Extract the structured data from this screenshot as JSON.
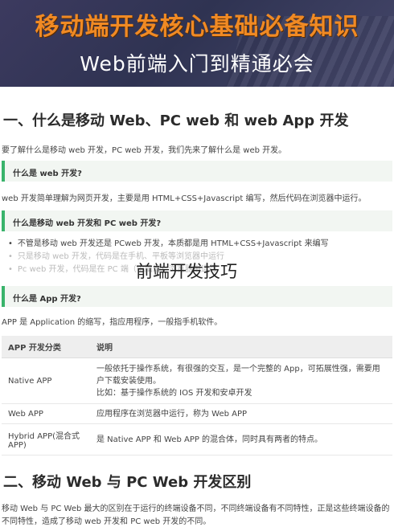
{
  "banner": {
    "title": "移动端开发核心基础必备知识",
    "subtitle": "Web前端入门到精通必会"
  },
  "section1": {
    "heading": "一、什么是移动 Web、PC web 和 web App 开发",
    "intro": "要了解什么是移动 web 开发，PC web 开发，我们先来了解什么是 web 开发。",
    "callout_web": "什么是 web 开发?",
    "web_desc": "web 开发简单理解为网页开发，主要是用 HTML+CSS+Javascript 编写，然后代码在浏览器中运行。",
    "callout_mobile_pc": "什么是移动 web 开发和 PC web 开发?",
    "bullets": [
      "不管是移动 web 开发还是 PCweb 开发，本质都是用 HTML+CSS+Javascript 来编写",
      "只是移动 web 开发，代码是在手机、平板等浏览器中运行",
      "Pc web 开发，代码是在 PC 端（电脑端）浏览器中运行"
    ],
    "watermark": "前端开发技巧",
    "callout_app": "什么是 App 开发?",
    "app_desc": "APP 是 Application 的缩写，指应用程序，一般指手机软件。"
  },
  "table": {
    "headers": [
      "APP 开发分类",
      "说明"
    ],
    "rows": [
      {
        "type": "Native APP",
        "desc": [
          "一般依托于操作系统，有很强的交互，是一个完整的 App，可拓展性强，需要用",
          "户下载安装使用。",
          "比如：基于操作系统的 IOS 开发和安卓开发"
        ]
      },
      {
        "type": "Web APP",
        "desc": [
          "应用程序在浏览器中运行，称为 Web APP"
        ]
      },
      {
        "type": "Hybrid APP(混合式APP)",
        "desc": [
          "是 Native APP 和 Web APP 的混合体，同时具有两者的特点。"
        ]
      }
    ]
  },
  "section2": {
    "heading": "二、移动 Web 与 PC Web 开发区别",
    "para_lines": [
      "移动 Web 与 PC Web 最大的区别在于运行的终端设备不同，不同终端设备有不同特性，正是这些终端设备的",
      "不同特性，造成了移动 web 开发和 PC web 开发的不同。"
    ]
  },
  "colors": {
    "banner_title": "#f08a24",
    "accent_green": "#39b36b",
    "callout_bg": "#f2f6f2"
  }
}
